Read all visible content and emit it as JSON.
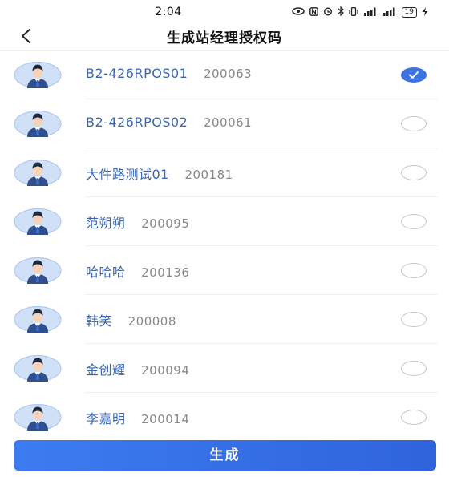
{
  "status_bar": {
    "time": "2:04",
    "battery": "19"
  },
  "header": {
    "back_icon": "chevron-left-icon",
    "title": "生成站经理授权码"
  },
  "managers": [
    {
      "name": "B2-426RPOS01",
      "code": "200063",
      "selected": true
    },
    {
      "name": "B2-426RPOS02",
      "code": "200061",
      "selected": false
    },
    {
      "name": "大件路测试01",
      "code": "200181",
      "selected": false
    },
    {
      "name": "范朔朔",
      "code": "200095",
      "selected": false
    },
    {
      "name": "哈哈哈",
      "code": "200136",
      "selected": false
    },
    {
      "name": "韩笑",
      "code": "200008",
      "selected": false
    },
    {
      "name": "金创耀",
      "code": "200094",
      "selected": false
    },
    {
      "name": "李嘉明",
      "code": "200014",
      "selected": false
    }
  ],
  "footer": {
    "generate_label": "生成"
  },
  "colors": {
    "accent": "#3b73e0",
    "name_text": "#3a67b5",
    "avatar_bg": "#cfe0f7"
  }
}
